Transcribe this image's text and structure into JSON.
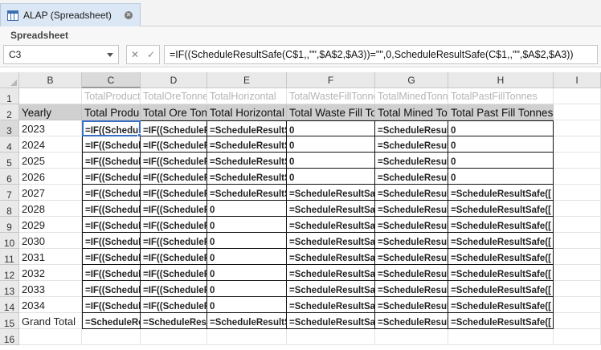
{
  "tab": {
    "title": "ALAP (Spreadsheet)",
    "close": "✕"
  },
  "ribbon": {
    "label": "Spreadsheet"
  },
  "formula_bar": {
    "name_box": "C3",
    "cancel": "✕",
    "confirm": "✓",
    "formula": "=IF((ScheduleResultSafe(C$1,,\"\",$A$2,$A3))=\"\",0,ScheduleResultSafe(C$1,,\"\",$A$2,$A3))"
  },
  "columns": [
    "B",
    "C",
    "D",
    "E",
    "F",
    "G",
    "H",
    "I"
  ],
  "rows": [
    "1",
    "2",
    "3",
    "4",
    "5",
    "6",
    "7",
    "8",
    "9",
    "10",
    "11",
    "12",
    "13",
    "14",
    "15",
    "16"
  ],
  "row1": [
    "",
    "TotalProductionTonnes",
    "TotalOreTonnes",
    "TotalHorizontal",
    "TotalWasteFillTonnes",
    "TotalMinedTonnes",
    "TotalPastFillTonnes"
  ],
  "row2": [
    "Yearly",
    "Total Production",
    "Total Ore Tonnes",
    "Total Horizontal",
    "Total Waste Fill Tonnes",
    "Total Mined Tonnes",
    "Total Past Fill Tonnes"
  ],
  "data_rows": [
    {
      "label": "2023",
      "cells": [
        "=IF((ScheduleResultSafe",
        "=IF((ScheduleResultSafe",
        "=ScheduleResultSafe",
        "0",
        "=ScheduleResultSafe",
        "0"
      ]
    },
    {
      "label": "2024",
      "cells": [
        "=IF((ScheduleResultSafe",
        "=IF((ScheduleResultSafe",
        "=ScheduleResultSafe",
        "0",
        "=ScheduleResultSafe",
        "0"
      ]
    },
    {
      "label": "2025",
      "cells": [
        "=IF((ScheduleResultSafe",
        "=IF((ScheduleResultSafe",
        "=ScheduleResultSafe",
        "0",
        "=ScheduleResultSafe",
        "0"
      ]
    },
    {
      "label": "2026",
      "cells": [
        "=IF((ScheduleResultSafe",
        "=IF((ScheduleResultSafe",
        "=ScheduleResultSafe",
        "0",
        "=ScheduleResultSafe",
        "0"
      ]
    },
    {
      "label": "2027",
      "cells": [
        "=IF((ScheduleResultSafe",
        "=IF((ScheduleResultSafe",
        "=ScheduleResultSafe",
        "=ScheduleResultSafe",
        "=ScheduleResultSafe",
        "=ScheduleResultSafe(["
      ]
    },
    {
      "label": "2028",
      "cells": [
        "=IF((ScheduleResultSafe",
        "=IF((ScheduleResultSafe",
        "0",
        "=ScheduleResultSafe",
        "=ScheduleResultSafe",
        "=ScheduleResultSafe(["
      ]
    },
    {
      "label": "2029",
      "cells": [
        "=IF((ScheduleResultSafe",
        "=IF((ScheduleResultSafe",
        "0",
        "=ScheduleResultSafe",
        "=ScheduleResultSafe",
        "=ScheduleResultSafe(["
      ]
    },
    {
      "label": "2030",
      "cells": [
        "=IF((ScheduleResultSafe",
        "=IF((ScheduleResultSafe",
        "0",
        "=ScheduleResultSafe",
        "=ScheduleResultSafe",
        "=ScheduleResultSafe(["
      ]
    },
    {
      "label": "2031",
      "cells": [
        "=IF((ScheduleResultSafe",
        "=IF((ScheduleResultSafe",
        "0",
        "=ScheduleResultSafe",
        "=ScheduleResultSafe",
        "=ScheduleResultSafe(["
      ]
    },
    {
      "label": "2032",
      "cells": [
        "=IF((ScheduleResultSafe",
        "=IF((ScheduleResultSafe",
        "0",
        "=ScheduleResultSafe",
        "=ScheduleResultSafe",
        "=ScheduleResultSafe(["
      ]
    },
    {
      "label": "2033",
      "cells": [
        "=IF((ScheduleResultSafe",
        "=IF((ScheduleResultSafe",
        "0",
        "=ScheduleResultSafe",
        "=ScheduleResultSafe",
        "=ScheduleResultSafe(["
      ]
    },
    {
      "label": "2034",
      "cells": [
        "=IF((ScheduleResultSafe",
        "=IF((ScheduleResultSafe",
        "0",
        "=ScheduleResultSafe",
        "=ScheduleResultSafe",
        "=ScheduleResultSafe(["
      ]
    },
    {
      "label": "Grand Total",
      "cells": [
        "=ScheduleResultSafe",
        "=ScheduleResultSafe",
        "=ScheduleResultSafe",
        "=ScheduleResultSafe",
        "=ScheduleResultSafe",
        "=ScheduleResultSafe(["
      ]
    }
  ],
  "active_cell": "C3",
  "colors": {
    "accent": "#3a6fc4",
    "header_fill": "#d0d0d0",
    "tab_fill": "#dbe7f5"
  }
}
